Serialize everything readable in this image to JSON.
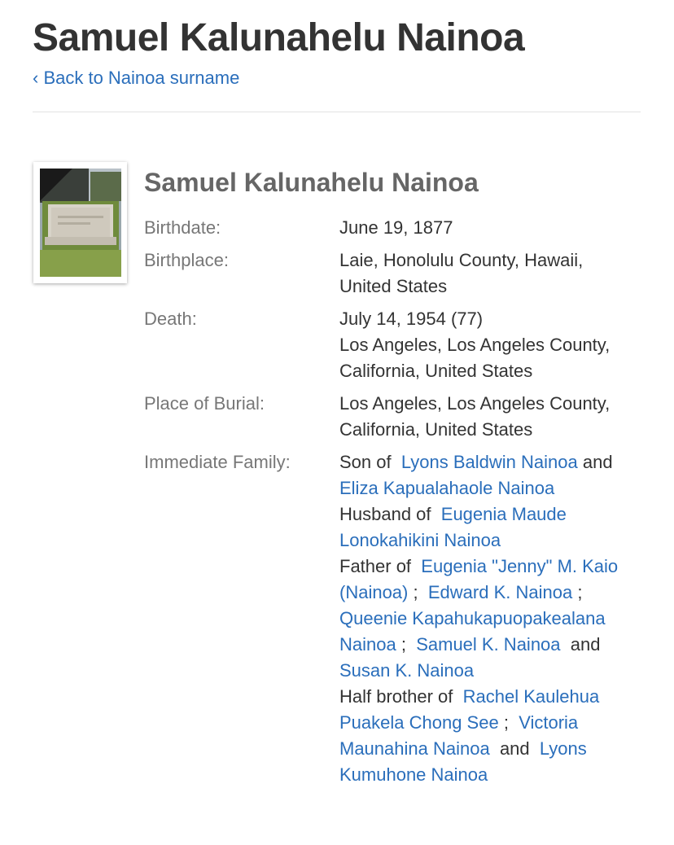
{
  "header": {
    "title": "Samuel Kalunahelu Nainoa",
    "back_link": "‹ Back to Nainoa surname"
  },
  "profile": {
    "photo_icon": "gravestone-photo",
    "name": "Samuel Kalunahelu Nainoa",
    "birthdate_label": "Birthdate:",
    "birthdate": "June 19, 1877",
    "birthplace_label": "Birthplace:",
    "birthplace": "Laie, Honolulu County, Hawaii, United States",
    "death_label": "Death:",
    "death_date": "July 14, 1954 (77)",
    "death_place": "Los Angeles, Los Angeles County, California, United States",
    "burial_label": "Place of Burial:",
    "burial_place": "Los Angeles, Los Angeles County, California, United States",
    "family_label": "Immediate Family:",
    "family": {
      "son_of_prefix": "Son of",
      "father": "Lyons Baldwin Nainoa",
      "and_1": "and",
      "mother": "Eliza Kapualahaole Nainoa",
      "husband_of_prefix": "Husband of",
      "wife": "Eugenia Maude Lonokahikini Nainoa",
      "father_of_prefix": "Father of",
      "children": [
        "Eugenia \"Jenny\" M. Kaio (Nainoa)",
        "Edward K. Nainoa",
        "Queenie Kapahukapuopakealana Nainoa",
        "Samuel K. Nainoa",
        "Susan K. Nainoa"
      ],
      "half_brother_of_prefix": "Half brother of",
      "half_siblings": [
        "Rachel Kaulehua Puakela Chong See",
        "Victoria Maunahina Nainoa",
        "Lyons Kumuhone Nainoa"
      ],
      "sep_semicolon": ";",
      "sep_and": "and"
    }
  },
  "colors": {
    "link": "#2a6ebb",
    "label": "#777777",
    "text": "#333333"
  }
}
